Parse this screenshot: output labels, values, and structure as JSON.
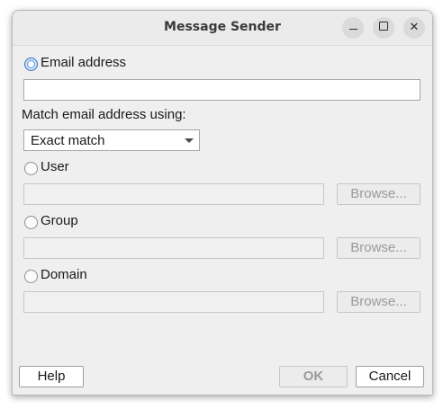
{
  "window": {
    "title": "Message Sender",
    "controls": {
      "minimize_icon": "minimize-icon",
      "maximize_icon": "maximize-icon",
      "close_icon": "close-icon"
    }
  },
  "options": {
    "email": {
      "label": "Email address",
      "selected": true,
      "value": ""
    },
    "match_label": "Match email address using:",
    "match_value": "Exact match",
    "user": {
      "label": "User",
      "selected": false,
      "value": "",
      "browse_label": "Browse..."
    },
    "group": {
      "label": "Group",
      "selected": false,
      "value": "",
      "browse_label": "Browse..."
    },
    "domain": {
      "label": "Domain",
      "selected": false,
      "value": "",
      "browse_label": "Browse..."
    }
  },
  "footer": {
    "help_label": "Help",
    "ok_label": "OK",
    "cancel_label": "Cancel"
  },
  "colors": {
    "radio_selected": "#5b9ae0",
    "window_bg": "#efefef"
  }
}
